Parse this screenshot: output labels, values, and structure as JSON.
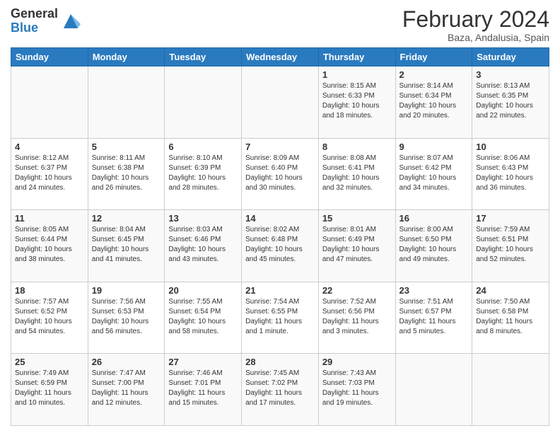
{
  "header": {
    "logo_general": "General",
    "logo_blue": "Blue",
    "title": "February 2024",
    "subtitle": "Baza, Andalusia, Spain"
  },
  "days_of_week": [
    "Sunday",
    "Monday",
    "Tuesday",
    "Wednesday",
    "Thursday",
    "Friday",
    "Saturday"
  ],
  "weeks": [
    [
      {
        "day": "",
        "info": ""
      },
      {
        "day": "",
        "info": ""
      },
      {
        "day": "",
        "info": ""
      },
      {
        "day": "",
        "info": ""
      },
      {
        "day": "1",
        "info": "Sunrise: 8:15 AM\nSunset: 6:33 PM\nDaylight: 10 hours and 18 minutes."
      },
      {
        "day": "2",
        "info": "Sunrise: 8:14 AM\nSunset: 6:34 PM\nDaylight: 10 hours and 20 minutes."
      },
      {
        "day": "3",
        "info": "Sunrise: 8:13 AM\nSunset: 6:35 PM\nDaylight: 10 hours and 22 minutes."
      }
    ],
    [
      {
        "day": "4",
        "info": "Sunrise: 8:12 AM\nSunset: 6:37 PM\nDaylight: 10 hours and 24 minutes."
      },
      {
        "day": "5",
        "info": "Sunrise: 8:11 AM\nSunset: 6:38 PM\nDaylight: 10 hours and 26 minutes."
      },
      {
        "day": "6",
        "info": "Sunrise: 8:10 AM\nSunset: 6:39 PM\nDaylight: 10 hours and 28 minutes."
      },
      {
        "day": "7",
        "info": "Sunrise: 8:09 AM\nSunset: 6:40 PM\nDaylight: 10 hours and 30 minutes."
      },
      {
        "day": "8",
        "info": "Sunrise: 8:08 AM\nSunset: 6:41 PM\nDaylight: 10 hours and 32 minutes."
      },
      {
        "day": "9",
        "info": "Sunrise: 8:07 AM\nSunset: 6:42 PM\nDaylight: 10 hours and 34 minutes."
      },
      {
        "day": "10",
        "info": "Sunrise: 8:06 AM\nSunset: 6:43 PM\nDaylight: 10 hours and 36 minutes."
      }
    ],
    [
      {
        "day": "11",
        "info": "Sunrise: 8:05 AM\nSunset: 6:44 PM\nDaylight: 10 hours and 38 minutes."
      },
      {
        "day": "12",
        "info": "Sunrise: 8:04 AM\nSunset: 6:45 PM\nDaylight: 10 hours and 41 minutes."
      },
      {
        "day": "13",
        "info": "Sunrise: 8:03 AM\nSunset: 6:46 PM\nDaylight: 10 hours and 43 minutes."
      },
      {
        "day": "14",
        "info": "Sunrise: 8:02 AM\nSunset: 6:48 PM\nDaylight: 10 hours and 45 minutes."
      },
      {
        "day": "15",
        "info": "Sunrise: 8:01 AM\nSunset: 6:49 PM\nDaylight: 10 hours and 47 minutes."
      },
      {
        "day": "16",
        "info": "Sunrise: 8:00 AM\nSunset: 6:50 PM\nDaylight: 10 hours and 49 minutes."
      },
      {
        "day": "17",
        "info": "Sunrise: 7:59 AM\nSunset: 6:51 PM\nDaylight: 10 hours and 52 minutes."
      }
    ],
    [
      {
        "day": "18",
        "info": "Sunrise: 7:57 AM\nSunset: 6:52 PM\nDaylight: 10 hours and 54 minutes."
      },
      {
        "day": "19",
        "info": "Sunrise: 7:56 AM\nSunset: 6:53 PM\nDaylight: 10 hours and 56 minutes."
      },
      {
        "day": "20",
        "info": "Sunrise: 7:55 AM\nSunset: 6:54 PM\nDaylight: 10 hours and 58 minutes."
      },
      {
        "day": "21",
        "info": "Sunrise: 7:54 AM\nSunset: 6:55 PM\nDaylight: 11 hours and 1 minute."
      },
      {
        "day": "22",
        "info": "Sunrise: 7:52 AM\nSunset: 6:56 PM\nDaylight: 11 hours and 3 minutes."
      },
      {
        "day": "23",
        "info": "Sunrise: 7:51 AM\nSunset: 6:57 PM\nDaylight: 11 hours and 5 minutes."
      },
      {
        "day": "24",
        "info": "Sunrise: 7:50 AM\nSunset: 6:58 PM\nDaylight: 11 hours and 8 minutes."
      }
    ],
    [
      {
        "day": "25",
        "info": "Sunrise: 7:49 AM\nSunset: 6:59 PM\nDaylight: 11 hours and 10 minutes."
      },
      {
        "day": "26",
        "info": "Sunrise: 7:47 AM\nSunset: 7:00 PM\nDaylight: 11 hours and 12 minutes."
      },
      {
        "day": "27",
        "info": "Sunrise: 7:46 AM\nSunset: 7:01 PM\nDaylight: 11 hours and 15 minutes."
      },
      {
        "day": "28",
        "info": "Sunrise: 7:45 AM\nSunset: 7:02 PM\nDaylight: 11 hours and 17 minutes."
      },
      {
        "day": "29",
        "info": "Sunrise: 7:43 AM\nSunset: 7:03 PM\nDaylight: 11 hours and 19 minutes."
      },
      {
        "day": "",
        "info": ""
      },
      {
        "day": "",
        "info": ""
      }
    ]
  ]
}
